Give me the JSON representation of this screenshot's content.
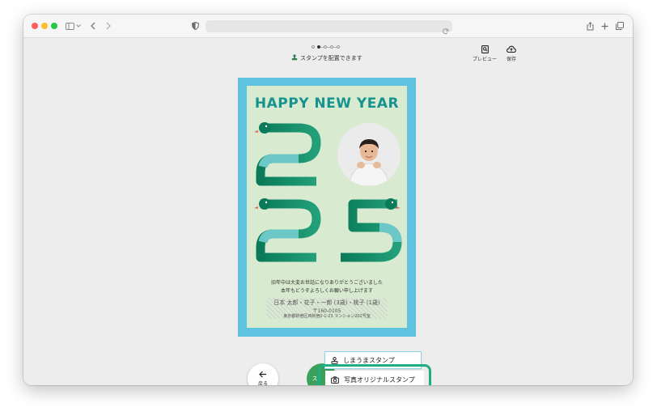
{
  "browser": {
    "traffic_lights": [
      "#ff5f57",
      "#febc2e",
      "#28c840"
    ],
    "icons": [
      "sidebar-icon",
      "chevron-down-icon",
      "back-icon",
      "forward-icon",
      "shield-icon",
      "reload-icon",
      "share-icon",
      "plus-icon",
      "tabs-icon"
    ]
  },
  "header": {
    "steps": [
      false,
      true,
      false,
      false,
      false
    ],
    "instruction": "スタンプを配置できます",
    "preview_label": "プレビュー",
    "save_label": "保存"
  },
  "card": {
    "title": "HAPPY NEW YEAR",
    "year_digits": [
      "2",
      "0",
      "2",
      "5"
    ],
    "message_line1": "旧年中は大変お世話になりありがとうございました",
    "message_line2": "本年もどうぞよろしくお願い申し上げます",
    "sender_line1": "日本 太郎・花子・一郎 (3歳)・桃子 (1歳)",
    "sender_line2": "〒160-0105",
    "sender_line3": "東京都新宿区西新宿0-1-23 マンション202号室",
    "colors": {
      "frame": "#5fc3e0",
      "background": "#d8ead0",
      "title": "#17938f",
      "snake_dark": "#0a7a58",
      "snake_light": "#6cc8c6"
    }
  },
  "bottom": {
    "back_label": "戻る",
    "stamp_btn_label": "ス",
    "menu": [
      {
        "icon": "stamp-icon",
        "label": "しまうまスタンプ"
      },
      {
        "icon": "camera-icon",
        "label": "写真オリジナルスタンプ"
      }
    ],
    "highlight_color": "#1fae84"
  }
}
